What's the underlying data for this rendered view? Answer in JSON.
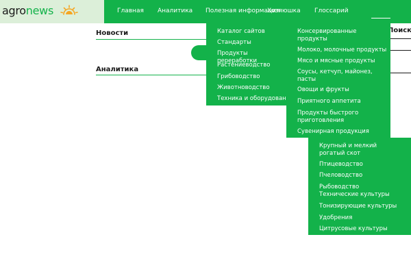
{
  "logo": {
    "part1": "agro",
    "part2": "news"
  },
  "nav": {
    "items": [
      {
        "label": "Главная"
      },
      {
        "label": "Аналитика"
      },
      {
        "label": "Полезная информация"
      },
      {
        "label": "Хозяюшка"
      },
      {
        "label": "Глоссарий"
      }
    ]
  },
  "sections": {
    "news": "Новости",
    "analytics": "Аналитика"
  },
  "search": {
    "label": "Поиск п"
  },
  "menu": {
    "col1": [
      "Каталог сайтов",
      "Стандарты",
      "Продукты переработки",
      "Растениеводство",
      "Грибоводство",
      "Животноводство",
      "Техника и оборудование"
    ],
    "col2": [
      "Консервированные продукты",
      "Молоко, молочные продукты",
      "Мясо и мясные продукты",
      "Соусы, кетчуп, майонез, пасты",
      "Овощи и фрукты",
      "Приятного аппетита",
      "Продукты быстрого приготовления",
      "Сувенирная продукция"
    ],
    "col3": [
      "Крупный и мелкий рогатый скот",
      "Птицеводство",
      "Пчеловодство",
      "Рыбоводство",
      "Технические культуры",
      "Тонизирующие культуры",
      "Удобрения",
      "Цитрусовые культуры"
    ]
  },
  "colors": {
    "accent": "#13b24a",
    "logo_bg": "#dcefd9",
    "sun": "#f5a623"
  }
}
